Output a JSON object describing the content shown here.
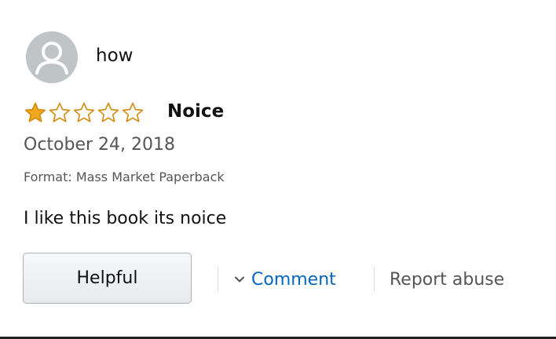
{
  "review": {
    "reviewer_name": "how",
    "avatar_icon": "person-icon",
    "rating": 1,
    "rating_max": 5,
    "title": "Noice",
    "date": "October 24, 2018",
    "format": "Format: Mass Market Paperback",
    "body": "I like this book its noice"
  },
  "actions": {
    "helpful_label": "Helpful",
    "comment_label": "Comment",
    "comment_icon": "chevron-down-icon",
    "report_label": "Report abuse"
  },
  "colors": {
    "star_filled": "#f0a91f",
    "star_outline": "#d48a0c",
    "link": "#0066c0",
    "muted_text": "#555555"
  }
}
